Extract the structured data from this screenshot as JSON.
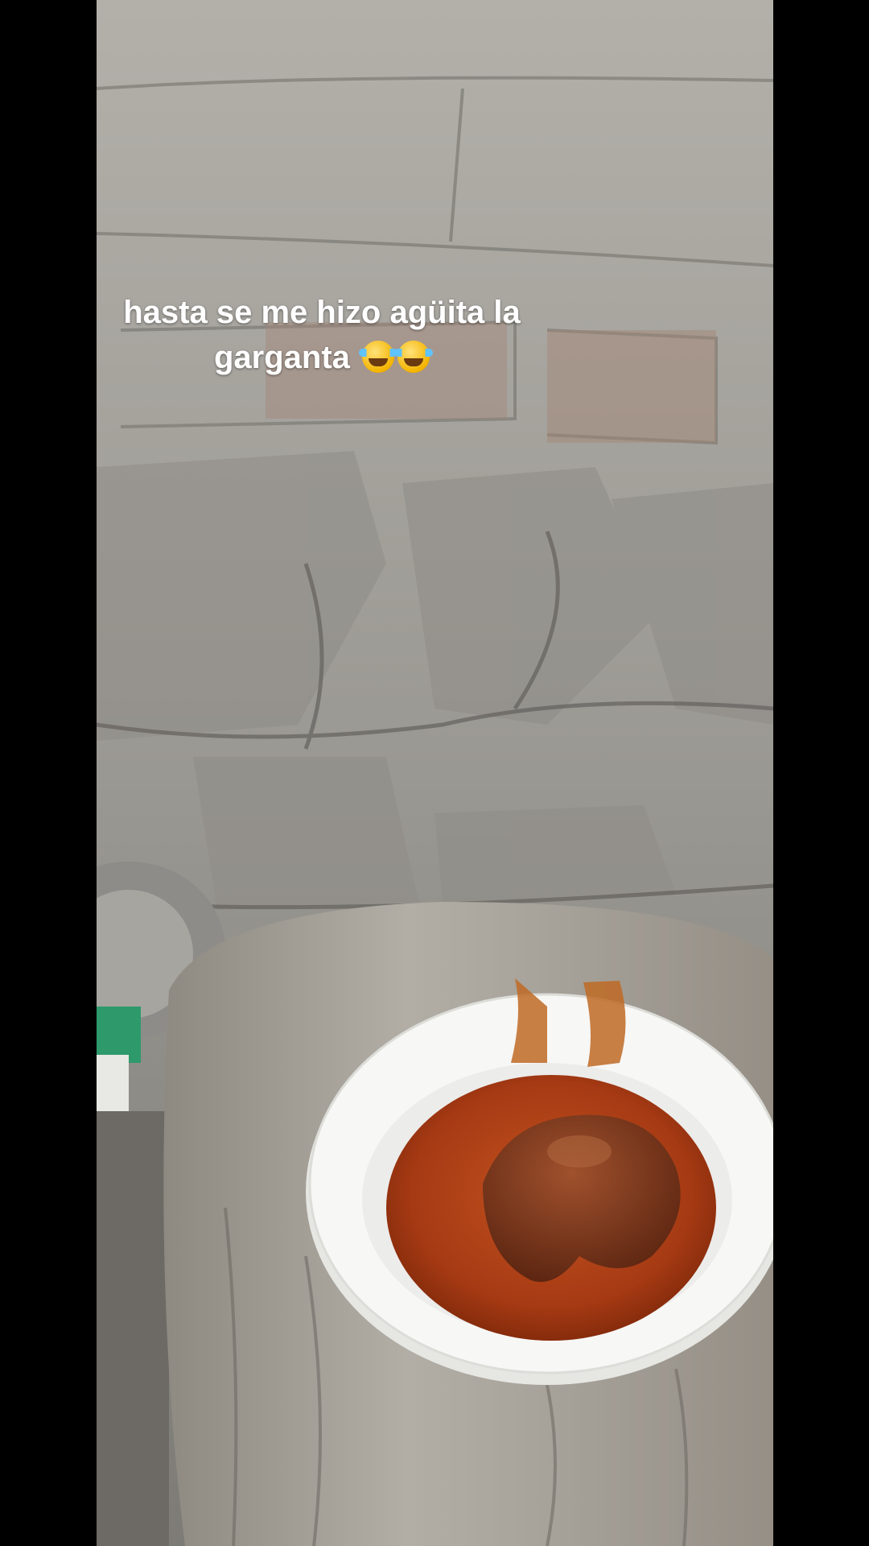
{
  "caption": {
    "line1": "hasta se me hizo agüita la",
    "line2": "garganta",
    "emojis": [
      "face-with-tears-of-joy-icon",
      "face-with-tears-of-joy-icon"
    ]
  },
  "colors": {
    "letterbox": "#000000",
    "wall": "#9d9b96",
    "plate": "#f4f4f2",
    "sauce": "#b4441a",
    "stump": "#a8a49c",
    "caption_text": "#ffffff"
  }
}
